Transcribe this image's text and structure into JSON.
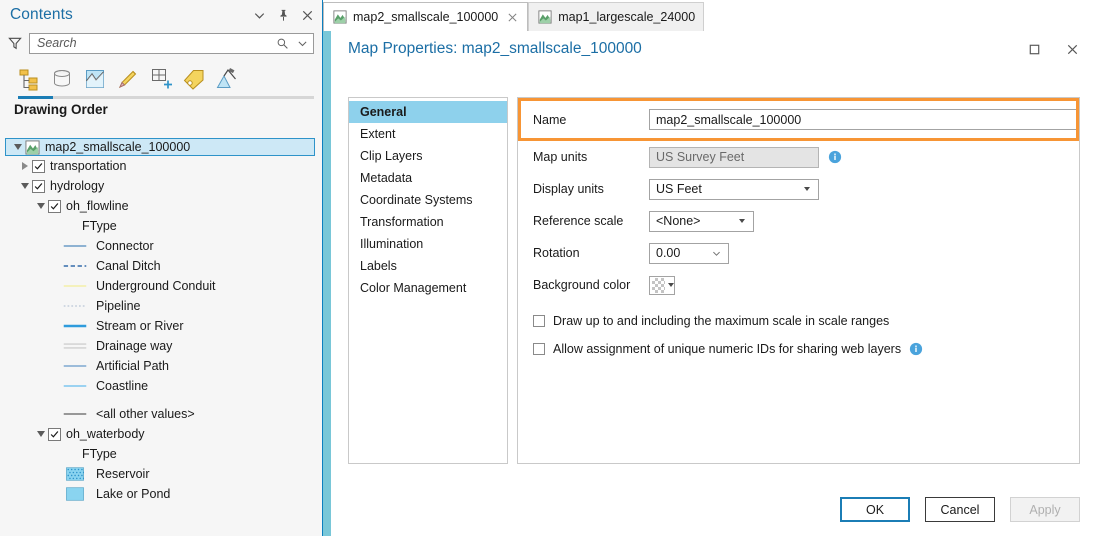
{
  "contents_panel": {
    "title": "Contents",
    "header_icons": [
      "chevron-down-icon",
      "pin-icon",
      "close-icon"
    ],
    "search": {
      "placeholder": "Search",
      "filter_icon": "funnel-icon",
      "submit_icon": "magnifier-icon",
      "dropdown_icon": "chevron-down-icon"
    },
    "toolbar_icons": [
      "list-by-drawing-order-icon",
      "list-by-data-source-icon",
      "list-by-selection-icon",
      "list-by-editing-icon",
      "list-by-snapping-icon",
      "list-by-labeling-icon",
      "list-by-elevation-icon"
    ],
    "section_label": "Drawing Order",
    "tree": [
      {
        "label": "map2_smallscale_100000",
        "level": 0,
        "type": "map",
        "selected": true,
        "expander": "open",
        "icon": "map-icon"
      },
      {
        "label": "transportation",
        "level": 1,
        "type": "group",
        "checked": true,
        "expander": "closed"
      },
      {
        "label": "hydrology",
        "level": 1,
        "type": "group",
        "checked": true,
        "expander": "open"
      },
      {
        "label": "oh_flowline",
        "level": 2,
        "type": "layer",
        "checked": true,
        "expander": "open"
      },
      {
        "label": "FType",
        "level": 3,
        "type": "field"
      },
      {
        "label": "Connector",
        "level": 3,
        "type": "line-symbol",
        "color": "#7fa8cc",
        "style": "solid",
        "width": 2
      },
      {
        "label": "Canal Ditch",
        "level": 3,
        "type": "line-symbol",
        "color": "#4f7fb5",
        "style": "dashed",
        "width": 2
      },
      {
        "label": "Underground Conduit",
        "level": 3,
        "type": "line-symbol",
        "color": "#f2ee9a",
        "style": "solid",
        "width": 1.5
      },
      {
        "label": "Pipeline",
        "level": 3,
        "type": "line-symbol",
        "color": "#b9c6d6",
        "style": "dotted",
        "width": 1.5
      },
      {
        "label": "Stream or River",
        "level": 3,
        "type": "line-symbol",
        "color": "#2e9bdc",
        "style": "solid",
        "width": 3
      },
      {
        "label": "Drainage way",
        "level": 3,
        "type": "line-symbol",
        "color": "#cfcfcf",
        "style": "double",
        "width": 2
      },
      {
        "label": "Artificial Path",
        "level": 3,
        "type": "line-symbol",
        "color": "#8fb4d6",
        "style": "solid",
        "width": 2
      },
      {
        "label": "Coastline",
        "level": 3,
        "type": "line-symbol",
        "color": "#8ecdf0",
        "style": "solid",
        "width": 2
      },
      {
        "label": "<all other values>",
        "level": 3,
        "type": "line-symbol",
        "color": "#8a8a8a",
        "style": "solid",
        "width": 2,
        "gap_before": true
      },
      {
        "label": "oh_waterbody",
        "level": 2,
        "type": "layer",
        "checked": true,
        "expander": "open"
      },
      {
        "label": "FType",
        "level": 3,
        "type": "field"
      },
      {
        "label": "Reservoir",
        "level": 3,
        "type": "fill-symbol",
        "color": "#8ad4f0",
        "pattern": "dotted"
      },
      {
        "label": "Lake or Pond",
        "level": 3,
        "type": "fill-symbol",
        "color": "#8ad4f0",
        "pattern": "solid"
      }
    ]
  },
  "tabs": [
    {
      "label": "map2_smallscale_100000",
      "active": true,
      "icon": "map-icon",
      "closable": true
    },
    {
      "label": "map1_largescale_24000",
      "active": false,
      "icon": "map-icon",
      "closable": false
    }
  ],
  "dialog": {
    "title": "Map Properties: map2_smallscale_100000",
    "maximize_icon": "maximize-icon",
    "close_icon": "close-icon",
    "nav_items": [
      {
        "label": "General",
        "selected": true
      },
      {
        "label": "Extent",
        "selected": false
      },
      {
        "label": "Clip Layers",
        "selected": false
      },
      {
        "label": "Metadata",
        "selected": false
      },
      {
        "label": "Coordinate Systems",
        "selected": false
      },
      {
        "label": "Transformation",
        "selected": false
      },
      {
        "label": "Illumination",
        "selected": false
      },
      {
        "label": "Labels",
        "selected": false
      },
      {
        "label": "Color Management",
        "selected": false
      }
    ],
    "form": {
      "name_label": "Name",
      "name_value": "map2_smallscale_100000",
      "name_highlight_color": "#f79535",
      "map_units_label": "Map units",
      "map_units_value": "US Survey Feet",
      "map_units_disabled": true,
      "map_units_info_icon": "info-icon",
      "display_units_label": "Display units",
      "display_units_value": "US Feet",
      "reference_scale_label": "Reference scale",
      "reference_scale_value": "<None>",
      "rotation_label": "Rotation",
      "rotation_value": "0.00",
      "background_color_label": "Background color",
      "background_color_value": "No color",
      "checkbox_draw_max_scale": "Draw up to and including the maximum scale in scale ranges",
      "checkbox_draw_max_scale_checked": false,
      "checkbox_unique_ids": "Allow assignment of unique numeric IDs for sharing web layers",
      "checkbox_unique_ids_checked": false,
      "checkbox_unique_ids_info_icon": "info-icon"
    },
    "buttons": {
      "ok": "OK",
      "cancel": "Cancel",
      "apply": "Apply",
      "apply_disabled": true
    }
  }
}
